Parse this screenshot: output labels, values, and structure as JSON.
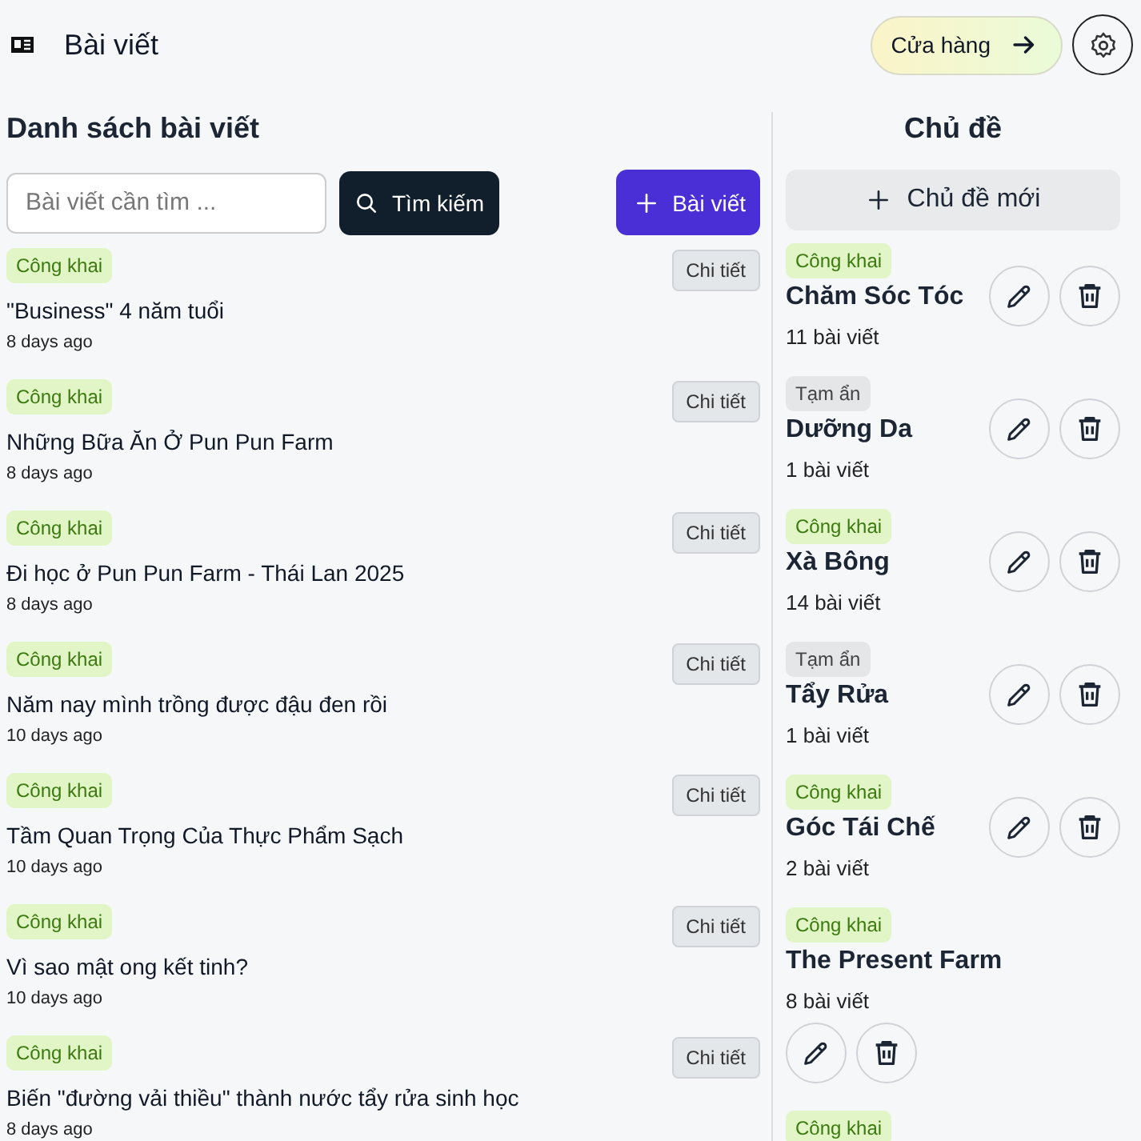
{
  "header": {
    "title": "Bài viết",
    "store_button": "Cửa hàng"
  },
  "posts_panel": {
    "title": "Danh sách bài viết",
    "search": {
      "placeholder": "Bài viết cần tìm ..."
    },
    "search_button": "Tìm kiếm",
    "new_button": "Bài viết",
    "posts": [
      {
        "hidden": false,
        "badge": "Công khai",
        "title": "\"Business\" 4 năm tuổi",
        "date": "8 days ago",
        "action": "Chi tiết"
      },
      {
        "hidden": false,
        "badge": "Công khai",
        "title": "Những Bữa Ăn Ở Pun Pun Farm",
        "date": "8 days ago",
        "action": "Chi tiết"
      },
      {
        "hidden": false,
        "badge": "Công khai",
        "title": "Đi học ở Pun Pun Farm - Thái Lan 2025",
        "date": "8 days ago",
        "action": "Chi tiết"
      },
      {
        "hidden": false,
        "badge": "Công khai",
        "title": "Năm nay mình trồng được đậu đen rồi",
        "date": "10 days ago",
        "action": "Chi tiết"
      },
      {
        "hidden": false,
        "badge": "Công khai",
        "title": "Tầm Quan Trọng Của Thực Phẩm Sạch",
        "date": "10 days ago",
        "action": "Chi tiết"
      },
      {
        "hidden": false,
        "badge": "Công khai",
        "title": "Vì sao mật ong kết tinh?",
        "date": "10 days ago",
        "action": "Chi tiết"
      },
      {
        "hidden": false,
        "badge": "Công khai",
        "title": "Biến \"đường vải thiều\" thành nước tẩy rửa sinh học",
        "date": "8 days ago",
        "action": "Chi tiết"
      }
    ]
  },
  "topics_panel": {
    "title": "Chủ đề",
    "new_button": "Chủ đề mới",
    "topics": [
      {
        "hidden": false,
        "badge": "Công khai",
        "name": "Chăm Sóc Tóc",
        "count": "11 bài viết"
      },
      {
        "hidden": true,
        "badge": "Tạm ẩn",
        "name": "Dưỡng Da",
        "count": "1 bài viết"
      },
      {
        "hidden": false,
        "badge": "Công khai",
        "name": "Xà Bông",
        "count": "14 bài viết"
      },
      {
        "hidden": true,
        "badge": "Tạm ẩn",
        "name": "Tẩy Rửa",
        "count": "1 bài viết"
      },
      {
        "hidden": false,
        "badge": "Công khai",
        "name": "Góc Tái Chế",
        "count": "2 bài viết"
      },
      {
        "hidden": false,
        "badge": "Công khai",
        "name": "The Present Farm",
        "count": "8 bài viết"
      },
      {
        "hidden": false,
        "badge": "Công khai"
      }
    ]
  }
}
